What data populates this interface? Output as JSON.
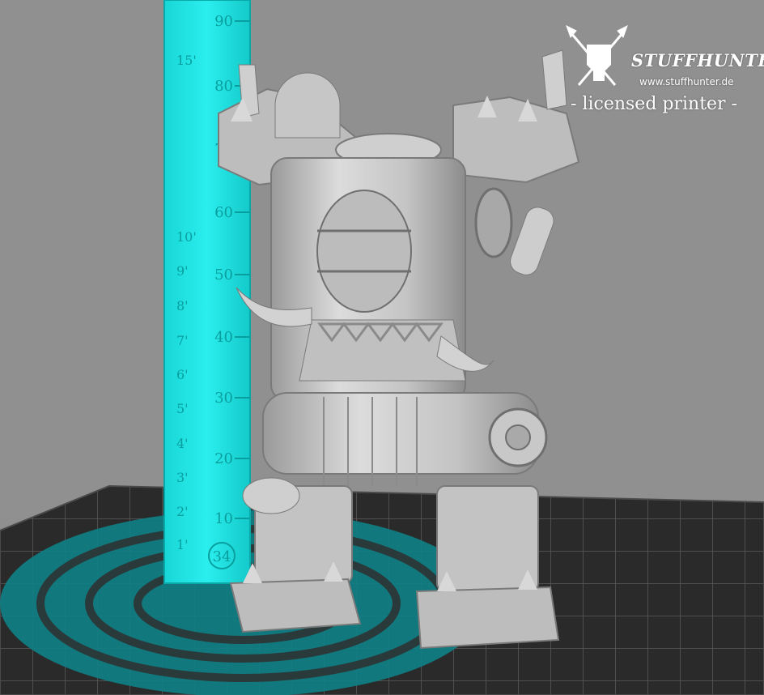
{
  "ruler": {
    "cm_labels": [
      "90",
      "80",
      "70",
      "60",
      "50",
      "40",
      "30",
      "20",
      "10"
    ],
    "inch_labels": [
      "15'",
      "10'",
      "9'",
      "8'",
      "7'",
      "6'",
      "5'",
      "4'",
      "3'",
      "2'",
      "1'"
    ],
    "badge": "34",
    "color": "#1ee4e4"
  },
  "watermark": {
    "brand": "STUFFHUNTER",
    "url": "www.stuffhunter.de",
    "tagline": "- licensed printer -"
  },
  "colors": {
    "background": "#8f8f8f",
    "floor_grid": "#2b2b2b",
    "floor_ring": "#0e7d82",
    "model": "#c9c9c9"
  }
}
